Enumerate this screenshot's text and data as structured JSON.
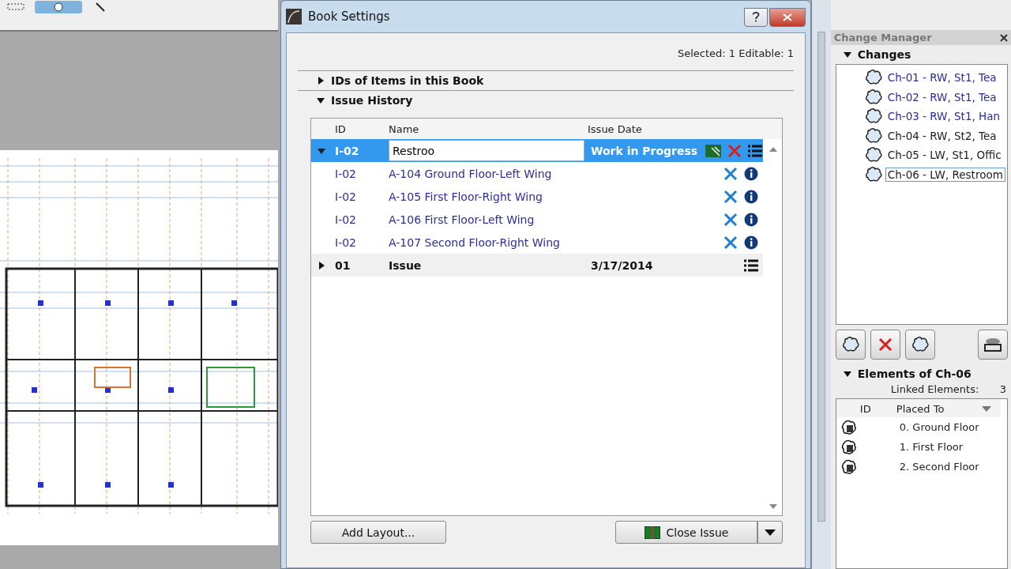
{
  "dialog": {
    "title": "Book Settings",
    "selection_info": "Selected: 1 Editable: 1",
    "sections": [
      {
        "label": "IDs of Items in this Book",
        "expanded": false
      },
      {
        "label": "Issue History",
        "expanded": true
      }
    ],
    "columns": [
      "ID",
      "Name",
      "Issue Date"
    ],
    "rows": [
      {
        "kind": "issue",
        "id": "I-02",
        "name": "Restroo",
        "date": "Work in Progress",
        "expanded": true,
        "selected": true
      },
      {
        "kind": "layout",
        "id": "I-02",
        "name": "A-104 Ground Floor-Left Wing"
      },
      {
        "kind": "layout",
        "id": "I-02",
        "name": "A-105 First Floor-Right Wing"
      },
      {
        "kind": "layout",
        "id": "I-02",
        "name": "A-106 First Floor-Left Wing"
      },
      {
        "kind": "layout",
        "id": "I-02",
        "name": "A-107 Second Floor-Right Wing"
      },
      {
        "kind": "issue",
        "id": "01",
        "name": "Issue",
        "date": "3/17/2014",
        "expanded": false,
        "selected": false
      }
    ],
    "add_button": "Add Layout...",
    "close_button": "Close Issue"
  },
  "change_manager": {
    "title": "Change Manager",
    "changes_label": "Changes",
    "changes": [
      {
        "label": "Ch-01 - RW, St1, Tea",
        "color": "#2b2b9a",
        "selected": false
      },
      {
        "label": "Ch-02 - RW, St1, Tea",
        "color": "#2b2b9a",
        "selected": false
      },
      {
        "label": "Ch-03 - RW, St1, Han",
        "color": "#2b2b9a",
        "selected": false
      },
      {
        "label": "Ch-04 - RW, St2, Tea",
        "color": "#202020",
        "selected": false
      },
      {
        "label": "Ch-05 - LW, St1, Offic",
        "color": "#202020",
        "selected": false
      },
      {
        "label": "Ch-06 - LW, Restroom",
        "color": "#202020",
        "selected": true
      }
    ],
    "elements_label": "Elements of Ch-06",
    "linked_label": "Linked Elements:",
    "linked_count": "3",
    "element_columns": [
      "ID",
      "Placed To"
    ],
    "elements": [
      "0. Ground Floor",
      "1. First Floor",
      "2. Second Floor"
    ]
  }
}
